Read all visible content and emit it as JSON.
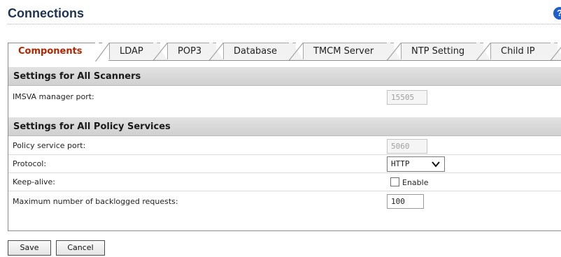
{
  "page": {
    "title": "Connections",
    "help_icon": "question-circle-icon",
    "help_glyph": "?"
  },
  "tabs": [
    {
      "label": "Components",
      "active": true
    },
    {
      "label": "LDAP",
      "active": false
    },
    {
      "label": "POP3",
      "active": false
    },
    {
      "label": "Database",
      "active": false
    },
    {
      "label": "TMCM Server",
      "active": false
    },
    {
      "label": "NTP Setting",
      "active": false
    },
    {
      "label": "Child IP",
      "active": false
    }
  ],
  "scanners": {
    "header": "Settings for All Scanners",
    "manager_port_label": "IMSVA manager port:",
    "manager_port_value": "15505"
  },
  "policy": {
    "header": "Settings for All Policy Services",
    "service_port_label": "Policy service port:",
    "service_port_value": "5060",
    "protocol_label": "Protocol:",
    "protocol_value": "HTTP",
    "keepalive_label": "Keep-alive:",
    "keepalive_checkbox_label": "Enable",
    "keepalive_checked": false,
    "backlog_label": "Maximum number of backlogged requests:",
    "backlog_value": "100"
  },
  "buttons": {
    "save": "Save",
    "cancel": "Cancel"
  },
  "colors": {
    "title": "#1f3350",
    "active_tab_text": "#b32400",
    "help_icon": "#1f5fc9",
    "section_header_bg": "#d8d8d8"
  }
}
